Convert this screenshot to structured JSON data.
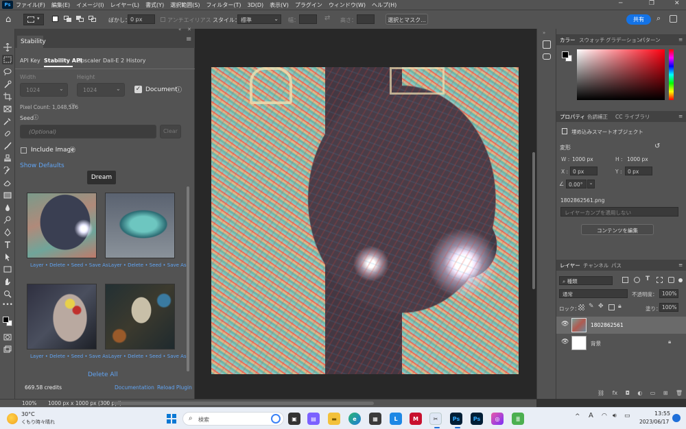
{
  "app": {
    "logo": "Ps",
    "menu": [
      "ファイル(F)",
      "編集(E)",
      "イメージ(I)",
      "レイヤー(L)",
      "書式(Y)",
      "選択範囲(S)",
      "フィルター(T)",
      "3D(D)",
      "表示(V)",
      "プラグイン",
      "ウィンドウ(W)",
      "ヘルプ(H)"
    ]
  },
  "options": {
    "feather_label": "ぼかし：",
    "feather_value": "0 px",
    "antialias_label": "アンチエイリアス",
    "style_label": "スタイル：",
    "style_value": "標準",
    "width_label": "幅：",
    "height_label": "高さ：",
    "select_mask": "選択とマスク...",
    "share": "共有"
  },
  "stability": {
    "panel_title": "Stability",
    "tabs": [
      "API Key",
      "Stability API",
      "Upscaler",
      "Dall-E 2",
      "History"
    ],
    "active_tab": "Stability API",
    "width_label": "Width",
    "height_label": "Height",
    "width_value": "1024",
    "height_value": "1024",
    "document_label": "Document",
    "pixel_count": "Pixel Count: 1,048,576",
    "seed_label": "Seed",
    "seed_placeholder": "(Optional)",
    "clear": "Clear",
    "include_image": "Include Image",
    "show_defaults": "Show Defaults",
    "dream": "Dream",
    "thumb_caption": "Layer • Delete • Seed • Save As",
    "delete_all": "Delete All",
    "credits": "669.58 credits",
    "documentation": "Documentation",
    "reload_plugin": "Reload Plugin"
  },
  "status": {
    "zoom": "100%",
    "doc_size": "1000 px x 1000 px (300 ppi)"
  },
  "color_panel": {
    "tabs": [
      "カラー",
      "スウォッチ",
      "グラデーション",
      "パターン"
    ],
    "active_tab": "カラー",
    "field_hue": "#ff0010"
  },
  "properties": {
    "tabs": [
      "プロパティ",
      "色調補正",
      "CC ライブラリ"
    ],
    "active_tab": "プロパティ",
    "object_type": "埋め込みスマートオブジェクト",
    "transform_label": "変形",
    "w_label": "W :",
    "w_value": "1000 px",
    "h_label": "H :",
    "h_value": "1000 px",
    "x_label": "X :",
    "x_value": "0 px",
    "y_label": "Y :",
    "y_value": "0 px",
    "angle_value": "0.00°",
    "filename": "1802862561.png",
    "layer_comp": "レイヤーカンプを適用しない",
    "edit_contents": "コンテンツを編集"
  },
  "layers": {
    "tabs": [
      "レイヤー",
      "チャンネル",
      "パス"
    ],
    "active_tab": "レイヤー",
    "kind": "種類",
    "blend_mode": "通常",
    "opacity_label": "不透明度：",
    "opacity_value": "100%",
    "lock_label": "ロック：",
    "fill_label": "塗り：",
    "fill_value": "100%",
    "items": [
      {
        "name": "1802862561"
      },
      {
        "name": "背景"
      }
    ]
  },
  "taskbar": {
    "temperature": "30°C",
    "weather": "くもり時々晴れ",
    "search": "検索",
    "time": "13:55",
    "date": "2023/06/17",
    "ime": "A"
  }
}
